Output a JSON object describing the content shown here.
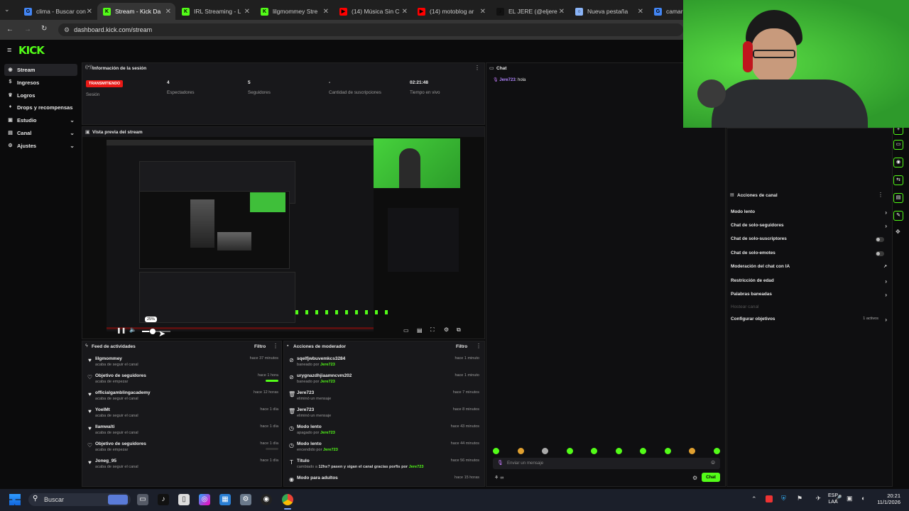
{
  "browser": {
    "tabs": [
      {
        "title": "clima - Buscar con",
        "color": "#4285f4",
        "glyph": "G"
      },
      {
        "title": "Stream - Kick Da",
        "color": "#53fc18",
        "glyph": "K"
      },
      {
        "title": "IRL Streaming - L",
        "color": "#53fc18",
        "glyph": "K"
      },
      {
        "title": "lilgmommey Stre",
        "color": "#53fc18",
        "glyph": "K"
      },
      {
        "title": "(14) Música Sin C",
        "color": "#ff0000",
        "glyph": "▶"
      },
      {
        "title": "(14) motoblog ar",
        "color": "#ff0000",
        "glyph": "▶"
      },
      {
        "title": "EL JERE (@eljere",
        "color": "#111111",
        "glyph": "♪"
      },
      {
        "title": "Nueva pestaña",
        "color": "#8ab4f8",
        "glyph": "○"
      },
      {
        "title": "camara",
        "color": "#4285f4",
        "glyph": "G"
      }
    ],
    "url": "dashboard.kick.com/stream"
  },
  "kick": {
    "logo": "KICK"
  },
  "sidebar": {
    "items": [
      {
        "label": "Stream",
        "icon": "broadcast-icon"
      },
      {
        "label": "Ingresos",
        "icon": "money-icon"
      },
      {
        "label": "Logros",
        "icon": "trophy-icon"
      },
      {
        "label": "Drops y recompensas",
        "icon": "gift-icon"
      },
      {
        "label": "Estudio",
        "icon": "studio-icon"
      },
      {
        "label": "Canal",
        "icon": "channel-icon"
      },
      {
        "label": "Ajustes",
        "icon": "settings-icon"
      }
    ]
  },
  "session": {
    "title": "Información de la sesión",
    "live_badge": "TRANSMITIENDO",
    "live_label": "Sesión",
    "stats": [
      {
        "value": "4",
        "label": "Espectadores"
      },
      {
        "value": "5",
        "label": "Seguidores"
      },
      {
        "value": "-",
        "label": "Cantidad de suscripciones"
      },
      {
        "value": "02:21:48",
        "label": "Tiempo en vivo"
      }
    ]
  },
  "preview": {
    "title": "Vista previa del stream",
    "volume_tooltip": "25%",
    "volume": 0.25
  },
  "chat": {
    "title": "Chat",
    "messages": [
      {
        "user": "Jere723",
        "text": ": hola"
      }
    ],
    "input_placeholder": "Enviar un mensaje",
    "send_label": "Chat"
  },
  "activity": {
    "title": "Feed de actividades",
    "filter": "Filtro",
    "items": [
      {
        "name": "lilgmommey",
        "desc": "acaba de seguir el canal",
        "time": "hace 37 minutos",
        "icon": "heart-icon"
      },
      {
        "name": "Objetivo de seguidores",
        "desc": "acaba de empezar",
        "time": "hace 1 hora",
        "icon": "heart-outline-icon",
        "progress": 1.0
      },
      {
        "name": "officialgamblingacademy",
        "desc": "acaba de seguir el canal",
        "time": "hace 12 horas",
        "icon": "heart-icon"
      },
      {
        "name": "YoelMt",
        "desc": "acaba de seguir el canal",
        "time": "hace 1 día",
        "icon": "heart-icon"
      },
      {
        "name": "llamwalti",
        "desc": "acaba de seguir el canal",
        "time": "hace 1 día",
        "icon": "heart-icon"
      },
      {
        "name": "Objetivo de seguidores",
        "desc": "acaba de empezar",
        "time": "hace 1 día",
        "icon": "heart-outline-icon",
        "progress": 0.0
      },
      {
        "name": "Joneg_95",
        "desc": "acaba de seguir el canal",
        "time": "hace 1 día",
        "icon": "heart-icon"
      }
    ]
  },
  "modactions": {
    "title": "Acciones de moderador",
    "filter": "Filtro",
    "items": [
      {
        "name": "sqelfjwbuvemkcs3284",
        "pre": "baneado por ",
        "by": "Jere723",
        "post": "",
        "time": "hace 1 minuto",
        "icon": "ban-icon"
      },
      {
        "name": "urygnazdhjiaamncvm202",
        "pre": "baneado por ",
        "by": "Jere723",
        "post": "",
        "time": "hace 1 minuto",
        "icon": "ban-icon"
      },
      {
        "name": "Jere723",
        "pre": "eliminó un mensaje",
        "by": "",
        "post": "",
        "time": "hace 7 minutos",
        "icon": "trash-icon"
      },
      {
        "name": "Jere723",
        "pre": "eliminó un mensaje",
        "by": "",
        "post": "",
        "time": "hace 8 minutos",
        "icon": "trash-icon"
      },
      {
        "name": "Modo lento",
        "pre": "apagado por ",
        "by": "Jere723",
        "post": "",
        "time": "hace 43 minutos",
        "icon": "clock-icon"
      },
      {
        "name": "Modo lento",
        "pre": "encendido por ",
        "by": "Jere723",
        "post": "",
        "time": "hace 44 minutos",
        "icon": "clock-icon"
      },
      {
        "name": "Título",
        "pre": "cambiado a ",
        "by": "Jere723",
        "post": "12hs? pasen y sigan el canal gracias porfis por ",
        "time": "hace 56 minutos",
        "icon": "title-icon"
      },
      {
        "name": "Modo para adultos",
        "pre": "",
        "by": "",
        "post": "",
        "time": "hace 15 horas",
        "icon": "eye-icon"
      }
    ]
  },
  "chatactions": {
    "title": "Acciones de canal",
    "items": [
      {
        "label": "Modo lento",
        "kind": "arrow"
      },
      {
        "label": "Chat de solo-seguidores",
        "kind": "arrow"
      },
      {
        "label": "Chat de solo-suscriptores",
        "kind": "toggle"
      },
      {
        "label": "Chat de solo-emotes",
        "kind": "toggle"
      },
      {
        "label": "Moderación del chat con IA",
        "kind": "ext"
      },
      {
        "label": "Restricción de edad",
        "kind": "arrow"
      },
      {
        "label": "Palabras baneadas",
        "kind": "arrow"
      },
      {
        "label": "Hostear canal",
        "kind": "disabled"
      },
      {
        "label": "Configurar objetivos",
        "kind": "arrow",
        "extra": "1 activos"
      }
    ]
  },
  "taskbar": {
    "search": "Buscar",
    "lang1": "ESP",
    "lang2": "LAA",
    "time": "20:21",
    "date": "11/1/2026"
  }
}
